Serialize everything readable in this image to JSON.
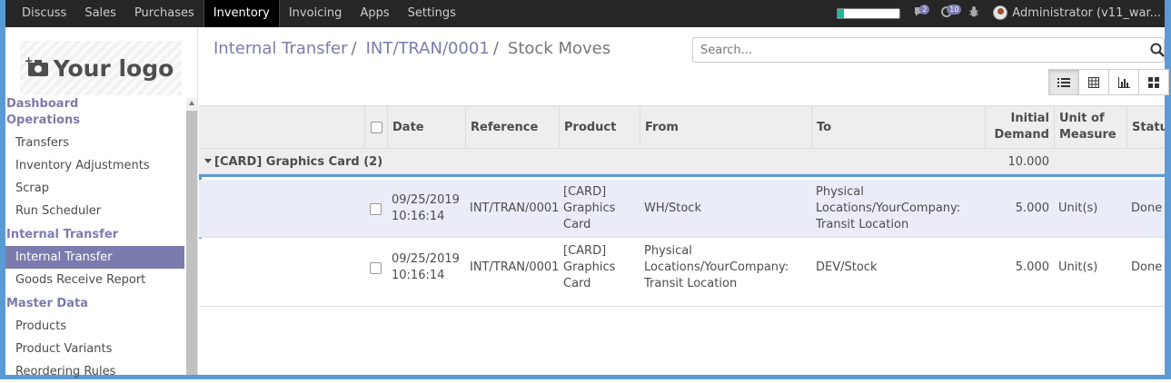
{
  "navbar": {
    "menu": [
      "Discuss",
      "Sales",
      "Purchases",
      "Inventory",
      "Invoicing",
      "Apps",
      "Settings"
    ],
    "active_index": 3,
    "progress": 0.1,
    "chat_badge": "2",
    "activity_badge": "10",
    "user_label": "Administrator (v11_war..."
  },
  "sidebar": {
    "logo_text": "Your logo",
    "sections": [
      {
        "title": "Dashboard"
      },
      {
        "title": "Operations",
        "items": [
          "Transfers",
          "Inventory Adjustments",
          "Scrap",
          "Run Scheduler"
        ]
      },
      {
        "title": "Internal Transfer",
        "items": [
          "Internal Transfer",
          "Goods Receive Report"
        ],
        "active_item": 0
      },
      {
        "title": "Master Data",
        "items": [
          "Products",
          "Product Variants",
          "Reordering Rules"
        ]
      }
    ]
  },
  "breadcrumb": {
    "items": [
      "Internal Transfer",
      "INT/TRAN/0001"
    ],
    "current": "Stock Moves",
    "separator": "/"
  },
  "search": {
    "placeholder": "Search..."
  },
  "views": [
    "list-view-icon",
    "pivot-view-icon",
    "graph-view-icon",
    "kanban-view-icon"
  ],
  "table": {
    "headers": {
      "date": "Date",
      "reference": "Reference",
      "product": "Product",
      "from": "From",
      "to": "To",
      "initial_demand_1": "Initial",
      "initial_demand_2": "Demand",
      "uom_1": "Unit of",
      "uom_2": "Measure",
      "status": "Status"
    },
    "group": {
      "label": "[CARD] Graphics Card (2)",
      "total": "10.000"
    },
    "rows": [
      {
        "date": "09/25/2019",
        "time": "10:16:14",
        "reference": "INT/TRAN/0001",
        "product": [
          "[CARD]",
          "Graphics",
          "Card"
        ],
        "from": [
          "WH/Stock"
        ],
        "to": [
          "Physical",
          "Locations/YourCompany:",
          "Transit Location"
        ],
        "qty": "5.000",
        "uom": "Unit(s)",
        "status": "Done"
      },
      {
        "date": "09/25/2019",
        "time": "10:16:14",
        "reference": "INT/TRAN/0001",
        "product": [
          "[CARD]",
          "Graphics",
          "Card"
        ],
        "from": [
          "Physical",
          "Locations/YourCompany:",
          "Transit Location"
        ],
        "to": [
          "DEV/Stock"
        ],
        "qty": "5.000",
        "uom": "Unit(s)",
        "status": "Done"
      }
    ]
  },
  "colors": {
    "accent": "#7c7bad",
    "frame": "#5b9bd5",
    "navbar": "#262626"
  }
}
